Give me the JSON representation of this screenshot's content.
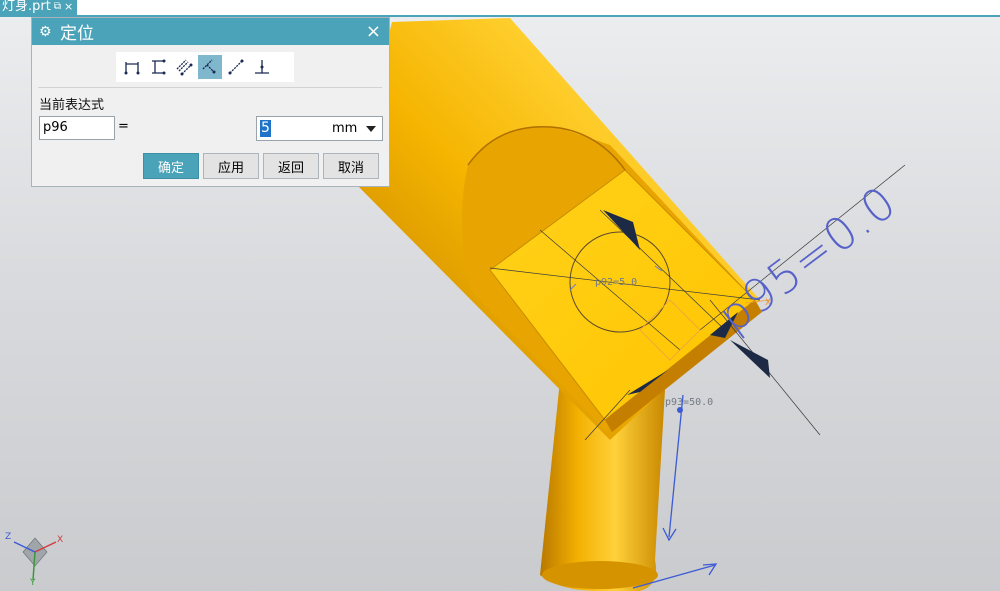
{
  "window": {
    "tab_title": "灯身.prt",
    "tab_icon": "pin-icon",
    "tab_close": "×"
  },
  "dialog": {
    "title": "定位",
    "gear_icon": "gear-icon",
    "close_icon": "×",
    "toolbar": [
      "horizontal-dim-icon",
      "vertical-dim-icon",
      "parallel-dim-icon",
      "perpendicular-dim-icon",
      "point-to-point-icon",
      "point-on-line-icon"
    ],
    "expression_label": "当前表达式",
    "name_value": "p96",
    "equals": "=",
    "value": "5",
    "unit": "mm",
    "buttons": {
      "ok": "确定",
      "apply": "应用",
      "back": "返回",
      "cancel": "取消"
    }
  },
  "viewport": {
    "annotations": {
      "large": "p95=0.0",
      "p92": "p92=5.0",
      "p93": "p93=50.0"
    },
    "axes": {
      "x": "X",
      "y": "Y",
      "z": "Z"
    },
    "colors": {
      "part": "#f5b400",
      "annotation": "#5762c8",
      "accent": "#4aa3b8"
    }
  }
}
